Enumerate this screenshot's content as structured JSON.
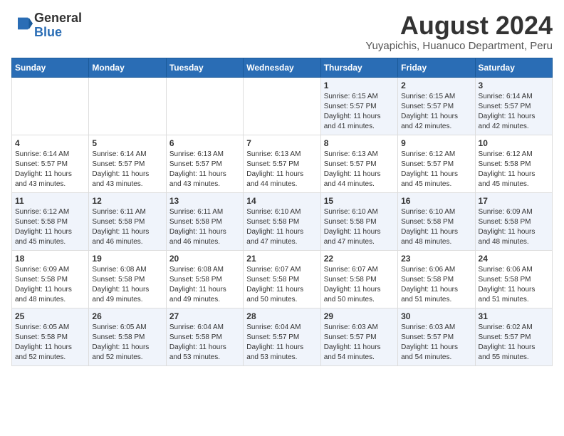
{
  "header": {
    "logo_line1": "General",
    "logo_line2": "Blue",
    "main_title": "August 2024",
    "subtitle": "Yuyapichis, Huanuco Department, Peru"
  },
  "days_of_week": [
    "Sunday",
    "Monday",
    "Tuesday",
    "Wednesday",
    "Thursday",
    "Friday",
    "Saturday"
  ],
  "weeks": [
    [
      {
        "day": "",
        "info": ""
      },
      {
        "day": "",
        "info": ""
      },
      {
        "day": "",
        "info": ""
      },
      {
        "day": "",
        "info": ""
      },
      {
        "day": "1",
        "info": "Sunrise: 6:15 AM\nSunset: 5:57 PM\nDaylight: 11 hours\nand 41 minutes."
      },
      {
        "day": "2",
        "info": "Sunrise: 6:15 AM\nSunset: 5:57 PM\nDaylight: 11 hours\nand 42 minutes."
      },
      {
        "day": "3",
        "info": "Sunrise: 6:14 AM\nSunset: 5:57 PM\nDaylight: 11 hours\nand 42 minutes."
      }
    ],
    [
      {
        "day": "4",
        "info": "Sunrise: 6:14 AM\nSunset: 5:57 PM\nDaylight: 11 hours\nand 43 minutes."
      },
      {
        "day": "5",
        "info": "Sunrise: 6:14 AM\nSunset: 5:57 PM\nDaylight: 11 hours\nand 43 minutes."
      },
      {
        "day": "6",
        "info": "Sunrise: 6:13 AM\nSunset: 5:57 PM\nDaylight: 11 hours\nand 43 minutes."
      },
      {
        "day": "7",
        "info": "Sunrise: 6:13 AM\nSunset: 5:57 PM\nDaylight: 11 hours\nand 44 minutes."
      },
      {
        "day": "8",
        "info": "Sunrise: 6:13 AM\nSunset: 5:57 PM\nDaylight: 11 hours\nand 44 minutes."
      },
      {
        "day": "9",
        "info": "Sunrise: 6:12 AM\nSunset: 5:57 PM\nDaylight: 11 hours\nand 45 minutes."
      },
      {
        "day": "10",
        "info": "Sunrise: 6:12 AM\nSunset: 5:58 PM\nDaylight: 11 hours\nand 45 minutes."
      }
    ],
    [
      {
        "day": "11",
        "info": "Sunrise: 6:12 AM\nSunset: 5:58 PM\nDaylight: 11 hours\nand 45 minutes."
      },
      {
        "day": "12",
        "info": "Sunrise: 6:11 AM\nSunset: 5:58 PM\nDaylight: 11 hours\nand 46 minutes."
      },
      {
        "day": "13",
        "info": "Sunrise: 6:11 AM\nSunset: 5:58 PM\nDaylight: 11 hours\nand 46 minutes."
      },
      {
        "day": "14",
        "info": "Sunrise: 6:10 AM\nSunset: 5:58 PM\nDaylight: 11 hours\nand 47 minutes."
      },
      {
        "day": "15",
        "info": "Sunrise: 6:10 AM\nSunset: 5:58 PM\nDaylight: 11 hours\nand 47 minutes."
      },
      {
        "day": "16",
        "info": "Sunrise: 6:10 AM\nSunset: 5:58 PM\nDaylight: 11 hours\nand 48 minutes."
      },
      {
        "day": "17",
        "info": "Sunrise: 6:09 AM\nSunset: 5:58 PM\nDaylight: 11 hours\nand 48 minutes."
      }
    ],
    [
      {
        "day": "18",
        "info": "Sunrise: 6:09 AM\nSunset: 5:58 PM\nDaylight: 11 hours\nand 48 minutes."
      },
      {
        "day": "19",
        "info": "Sunrise: 6:08 AM\nSunset: 5:58 PM\nDaylight: 11 hours\nand 49 minutes."
      },
      {
        "day": "20",
        "info": "Sunrise: 6:08 AM\nSunset: 5:58 PM\nDaylight: 11 hours\nand 49 minutes."
      },
      {
        "day": "21",
        "info": "Sunrise: 6:07 AM\nSunset: 5:58 PM\nDaylight: 11 hours\nand 50 minutes."
      },
      {
        "day": "22",
        "info": "Sunrise: 6:07 AM\nSunset: 5:58 PM\nDaylight: 11 hours\nand 50 minutes."
      },
      {
        "day": "23",
        "info": "Sunrise: 6:06 AM\nSunset: 5:58 PM\nDaylight: 11 hours\nand 51 minutes."
      },
      {
        "day": "24",
        "info": "Sunrise: 6:06 AM\nSunset: 5:58 PM\nDaylight: 11 hours\nand 51 minutes."
      }
    ],
    [
      {
        "day": "25",
        "info": "Sunrise: 6:05 AM\nSunset: 5:58 PM\nDaylight: 11 hours\nand 52 minutes."
      },
      {
        "day": "26",
        "info": "Sunrise: 6:05 AM\nSunset: 5:58 PM\nDaylight: 11 hours\nand 52 minutes."
      },
      {
        "day": "27",
        "info": "Sunrise: 6:04 AM\nSunset: 5:58 PM\nDaylight: 11 hours\nand 53 minutes."
      },
      {
        "day": "28",
        "info": "Sunrise: 6:04 AM\nSunset: 5:57 PM\nDaylight: 11 hours\nand 53 minutes."
      },
      {
        "day": "29",
        "info": "Sunrise: 6:03 AM\nSunset: 5:57 PM\nDaylight: 11 hours\nand 54 minutes."
      },
      {
        "day": "30",
        "info": "Sunrise: 6:03 AM\nSunset: 5:57 PM\nDaylight: 11 hours\nand 54 minutes."
      },
      {
        "day": "31",
        "info": "Sunrise: 6:02 AM\nSunset: 5:57 PM\nDaylight: 11 hours\nand 55 minutes."
      }
    ]
  ]
}
